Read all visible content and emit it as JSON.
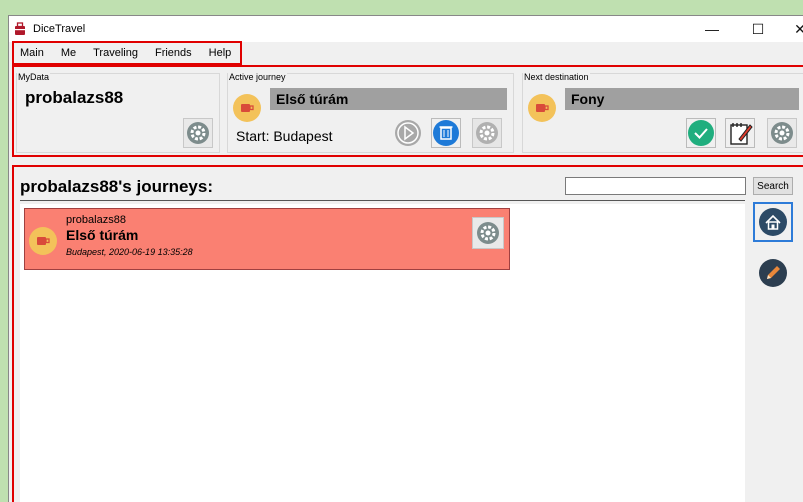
{
  "app": {
    "title": "DiceTravel"
  },
  "window_controls": {
    "minimize": "—",
    "maximize": "☐",
    "close": "✕"
  },
  "menu": [
    "Main",
    "Me",
    "Traveling",
    "Friends",
    "Help"
  ],
  "my_data": {
    "group_label": "MyData",
    "username": "probalazs88"
  },
  "active_journey": {
    "group_label": "Active journey",
    "name": "Első túrám",
    "start_label": "Start: Budapest"
  },
  "next_destination": {
    "group_label": "Next destination",
    "name": "Fony"
  },
  "journeys": {
    "title": "probalazs88's journeys:",
    "search_value": "",
    "search_button": "Search",
    "items": [
      {
        "user": "probalazs88",
        "name": "Első túrám",
        "meta": "Budapest, 2020-06-19 13:35:28"
      }
    ]
  },
  "colors": {
    "accent_red": "#e00000",
    "card_bg": "#fa8072",
    "cup_yellow": "#f3c25a",
    "check_green": "#1fae7e",
    "trash_blue": "#1e7ad8",
    "home_navy": "#2c4a66"
  },
  "icons": {
    "app": "bag-icon",
    "settings": "gear-icon",
    "cup": "cup-icon",
    "play": "play-icon",
    "delete": "trash-icon",
    "confirm": "check-icon",
    "edit": "notepad-icon",
    "home": "home-icon",
    "pencil": "pencil-icon"
  }
}
